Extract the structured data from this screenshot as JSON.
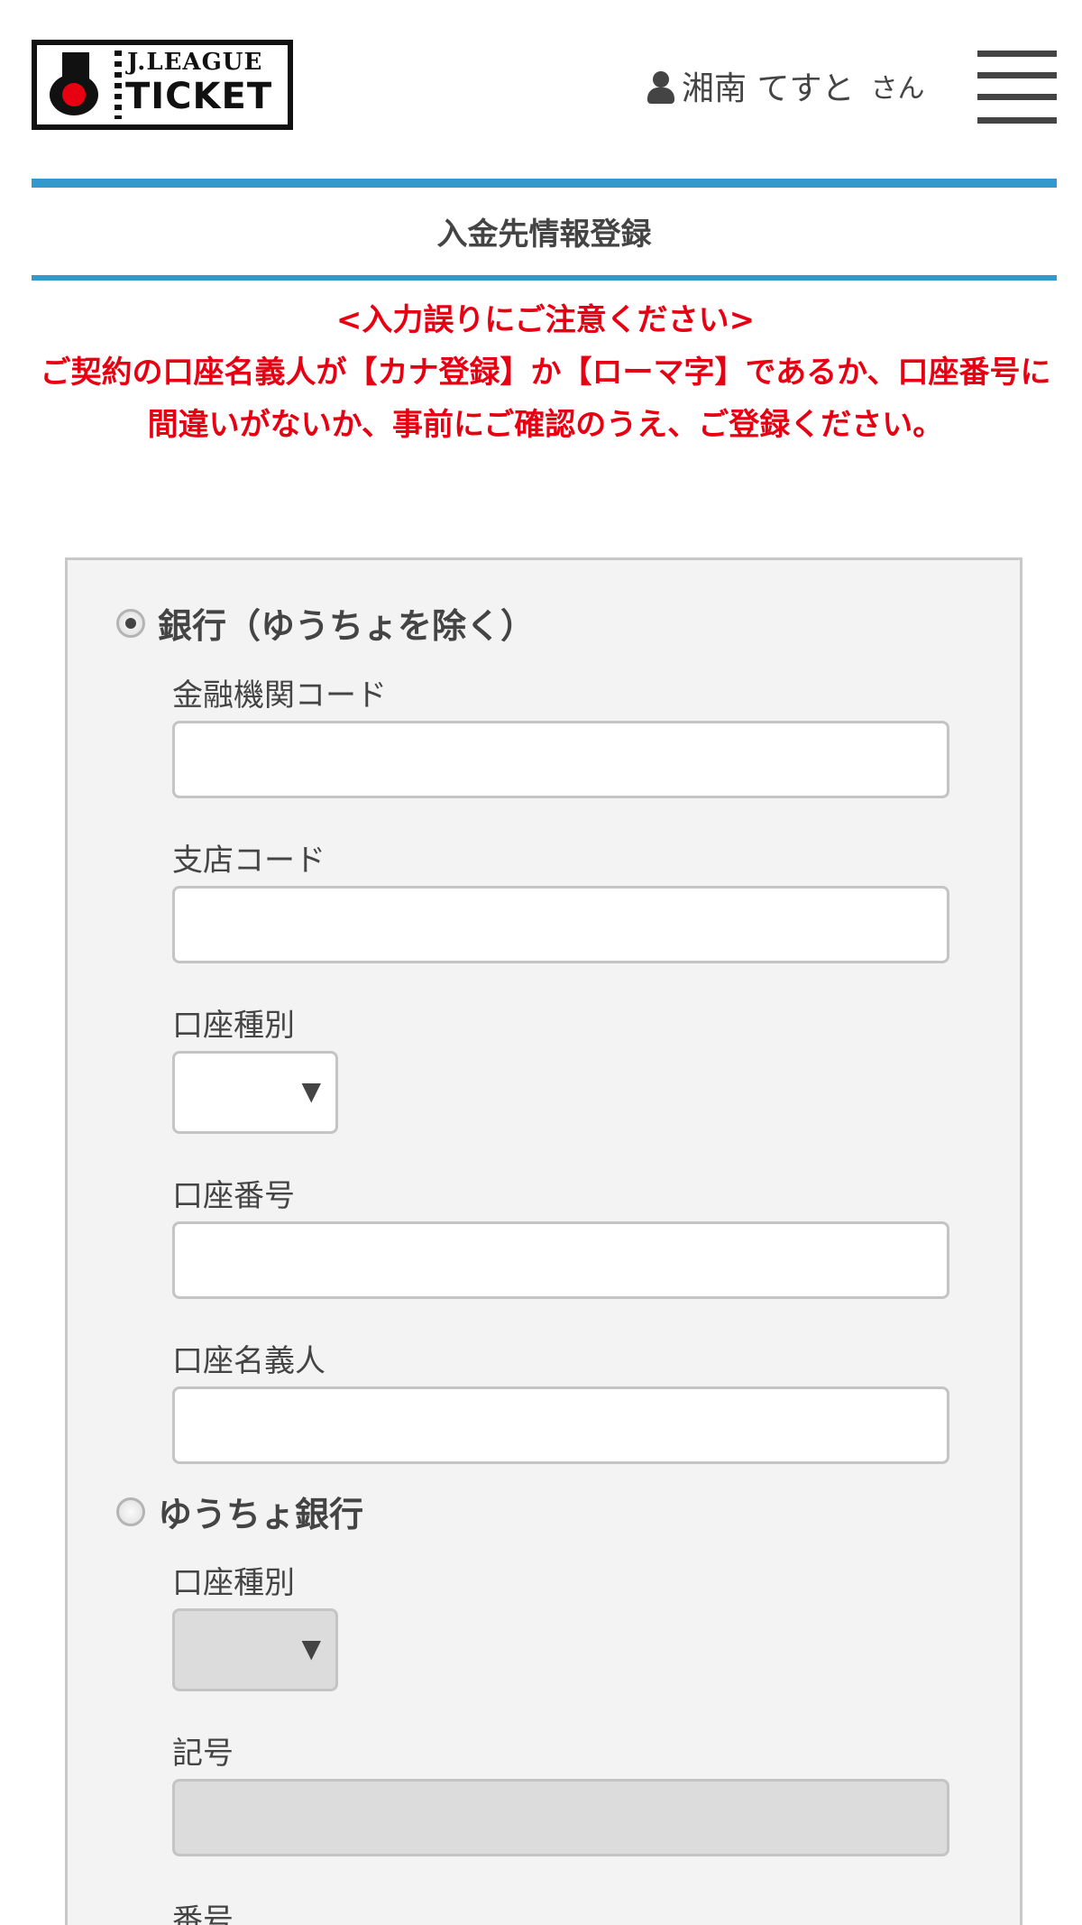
{
  "header": {
    "logo": {
      "text_top": "J.LEAGUE",
      "text_bottom": "TICKET"
    },
    "user": {
      "icon": "user-icon",
      "name": "湘南 てすと",
      "suffix": "さん"
    },
    "menu_icon": "hamburger-menu-icon"
  },
  "page": {
    "title": "入金先情報登録"
  },
  "warning": {
    "heading": "<入力誤りにご注意ください>",
    "body": "ご契約の口座名義人が【カナ登録】か【ローマ字】であるか、口座番号に間違いがないか、事前にご確認のうえ、ご登録ください。",
    "color": "#e60012"
  },
  "form": {
    "bank": {
      "option_label": "銀行（ゆうちょを除く）",
      "selected": true,
      "institution_code": {
        "label": "金融機関コード",
        "value": ""
      },
      "branch_code": {
        "label": "支店コード",
        "value": ""
      },
      "account_type": {
        "label": "口座種別",
        "value": ""
      },
      "account_number": {
        "label": "口座番号",
        "value": ""
      },
      "account_holder": {
        "label": "口座名義人",
        "value": ""
      }
    },
    "yucho": {
      "option_label": "ゆうちょ銀行",
      "selected": false,
      "account_type": {
        "label": "口座種別",
        "value": ""
      },
      "symbol": {
        "label": "記号",
        "value": ""
      },
      "number": {
        "label": "番号",
        "value": ""
      }
    }
  },
  "colors": {
    "accent": "#3399cc",
    "alert": "#e60012",
    "panel": "#f3f3f3",
    "disabled": "#dcdcdc"
  }
}
